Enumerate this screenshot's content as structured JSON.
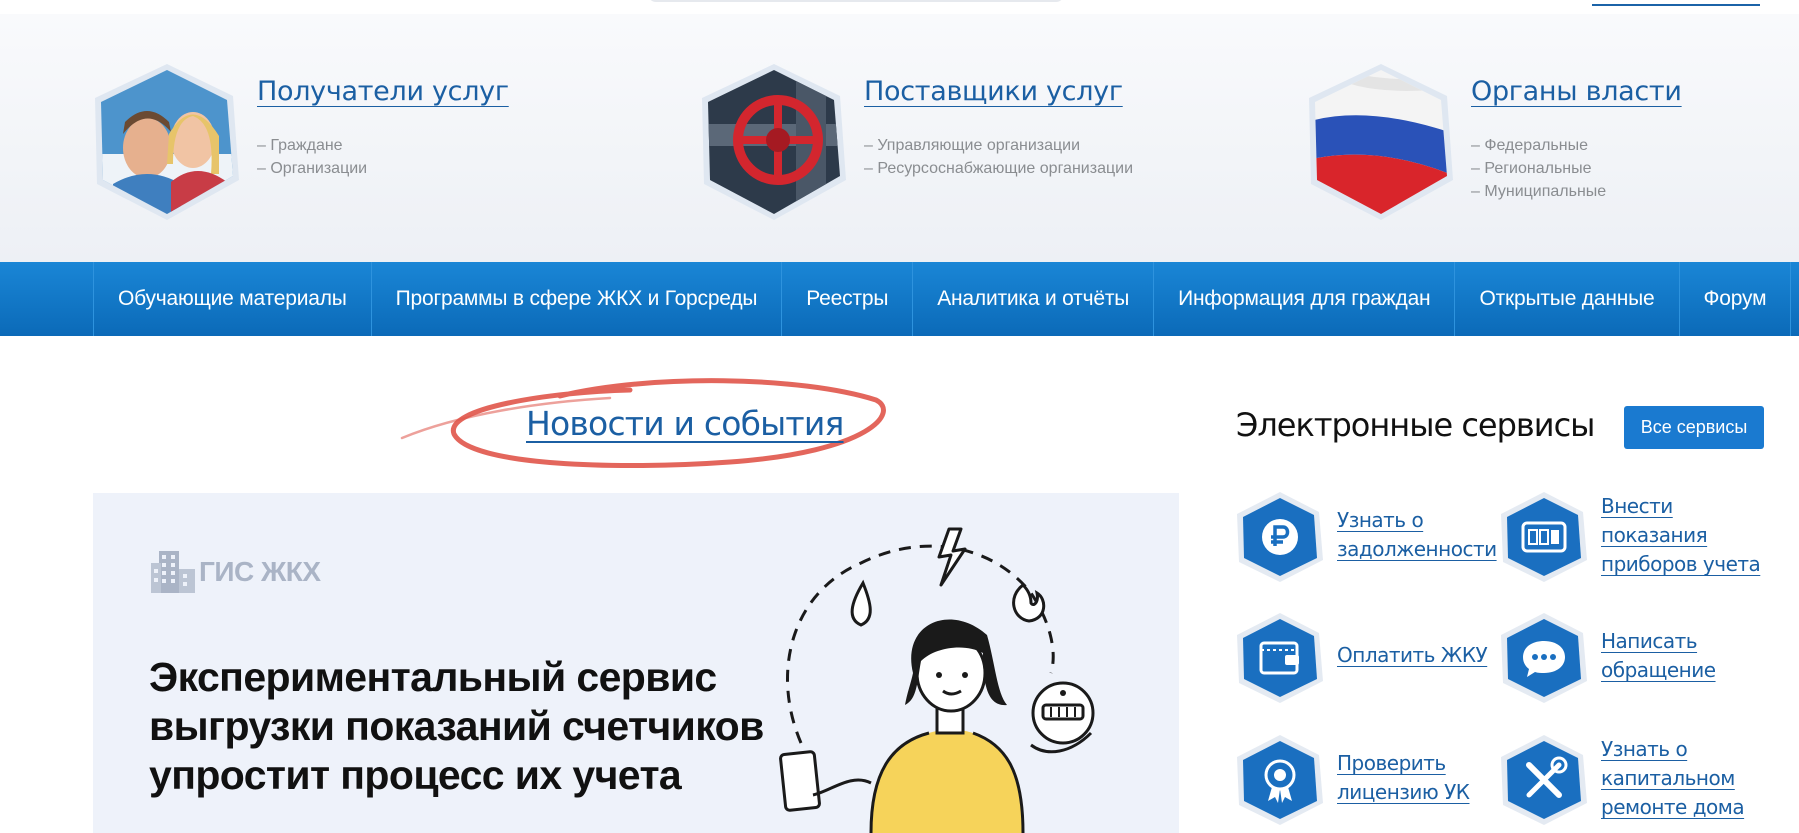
{
  "audience": [
    {
      "title": "Получатели услуг",
      "items": [
        "– Граждане",
        "– Организации"
      ],
      "image": "people-photo"
    },
    {
      "title": "Поставщики услуг",
      "items": [
        "– Управляющие организации",
        "– Ресурсоснабжающие организации"
      ],
      "image": "valve-photo"
    },
    {
      "title": "Органы власти",
      "items": [
        "– Федеральные",
        "– Региональные",
        "– Муниципальные"
      ],
      "image": "russian-flag-photo"
    }
  ],
  "nav": [
    "Обучающие материалы",
    "Программы в сфере ЖКХ и Горсреды",
    "Реестры",
    "Аналитика и отчёты",
    "Информация для граждан",
    "Открытые данные",
    "Форум"
  ],
  "news": {
    "title": "Новости и события"
  },
  "banner": {
    "logo": "ГИС ЖКХ",
    "headline": "Экспериментальный сервис выгрузки показаний счетчиков упростит процесс их учета"
  },
  "services": {
    "title": "Электронные сервисы",
    "all_button": "Все сервисы",
    "items": [
      {
        "lines": [
          "Узнать о",
          "задолженности"
        ],
        "icon": "ruble-icon"
      },
      {
        "lines": [
          "Внести",
          "показания",
          "приборов учета"
        ],
        "icon": "meter-icon"
      },
      {
        "lines": [
          "Оплатить ЖКУ"
        ],
        "icon": "wallet-icon"
      },
      {
        "lines": [
          "Написать",
          "обращение"
        ],
        "icon": "chat-icon"
      },
      {
        "lines": [
          "Проверить",
          "лицензию УК"
        ],
        "icon": "license-badge-icon"
      },
      {
        "lines": [
          "Узнать о",
          "капитальном",
          "ремонте дома"
        ],
        "icon": "tools-icon"
      }
    ]
  },
  "colors": {
    "brand_blue": "#1b5fa3",
    "nav_blue": "#0b6ab8",
    "button_blue": "#1a7ad0",
    "highlight_red": "#e0554a"
  }
}
